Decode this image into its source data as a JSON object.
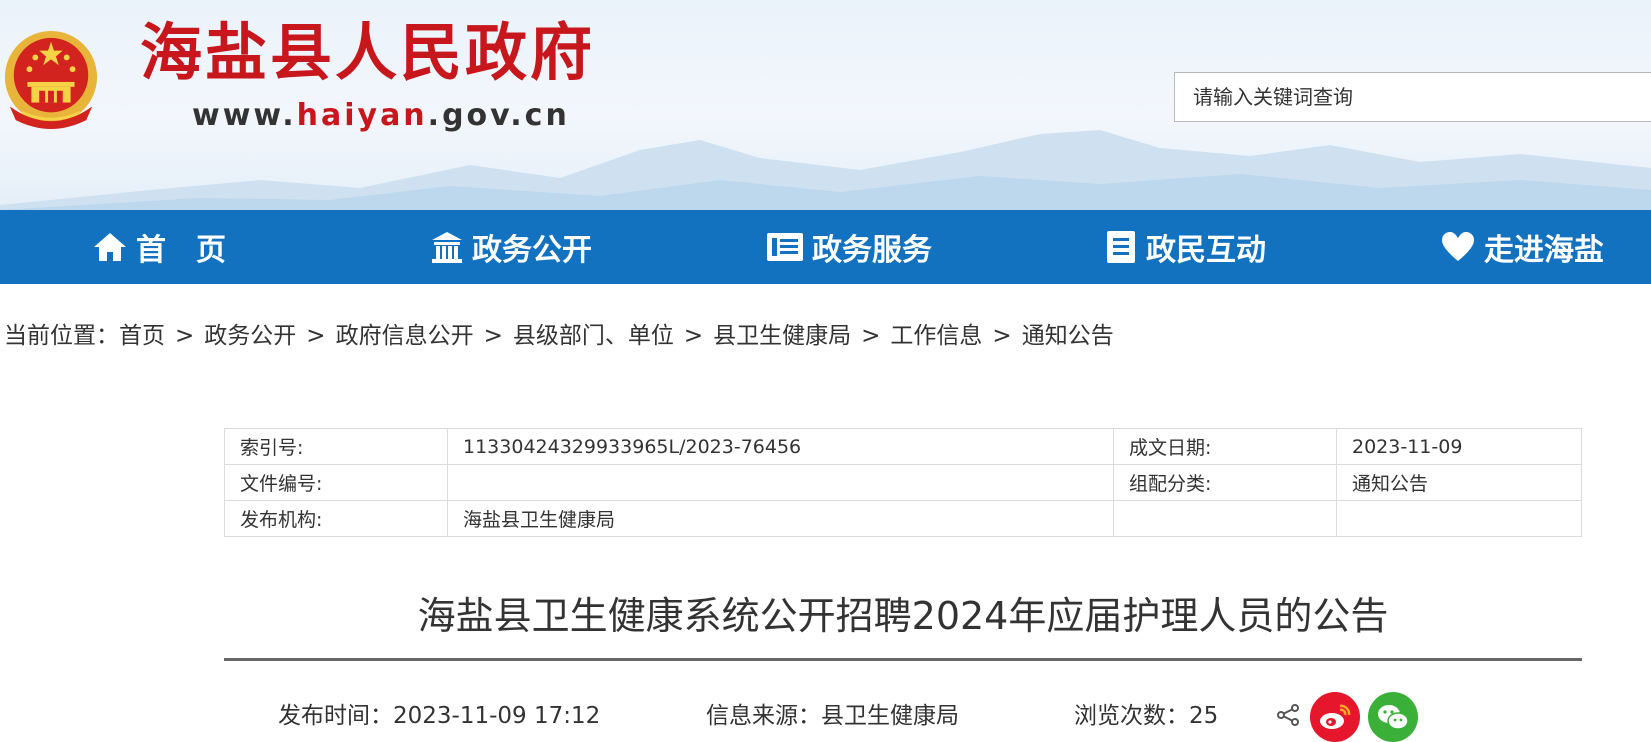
{
  "site": {
    "title": "海盐县人民政府",
    "url_prefix": "www.",
    "url_highlight": "haiyan",
    "url_suffix": ".gov.cn",
    "search_placeholder": "请输入关键词查询",
    "brand_red": "#c8161d",
    "nav_blue": "#1272c0"
  },
  "nav": {
    "items": [
      {
        "label": "首　页",
        "icon": "home-icon"
      },
      {
        "label": "政务公开",
        "icon": "building-icon"
      },
      {
        "label": "政务服务",
        "icon": "list-icon"
      },
      {
        "label": "政民互动",
        "icon": "document-icon"
      },
      {
        "label": "走进海盐",
        "icon": "heart-icon"
      }
    ]
  },
  "breadcrumb": {
    "prefix": "当前位置：",
    "items": [
      "首页",
      "政务公开",
      "政府信息公开",
      "县级部门、单位",
      "县卫生健康局",
      "工作信息",
      "通知公告"
    ],
    "separator": ">"
  },
  "meta": {
    "index_label": "索引号:",
    "index_value": "11330424329933965L/2023-76456",
    "date_label": "成文日期:",
    "date_value": "2023-11-09",
    "docno_label": "文件编号:",
    "docno_value": "",
    "category_label": "组配分类:",
    "category_value": "通知公告",
    "publisher_label": "发布机构:",
    "publisher_value": "海盐县卫生健康局"
  },
  "article": {
    "title": "海盐县卫生健康系统公开招聘2024年应届护理人员的公告",
    "publish_time_label": "发布时间：",
    "publish_time": "2023-11-09 17:12",
    "source_label": "信息来源：",
    "source": "县卫生健康局",
    "views_label": "浏览次数：",
    "views": "25"
  },
  "share": {
    "weibo_color": "#e6162d",
    "wechat_color": "#3bb039"
  }
}
